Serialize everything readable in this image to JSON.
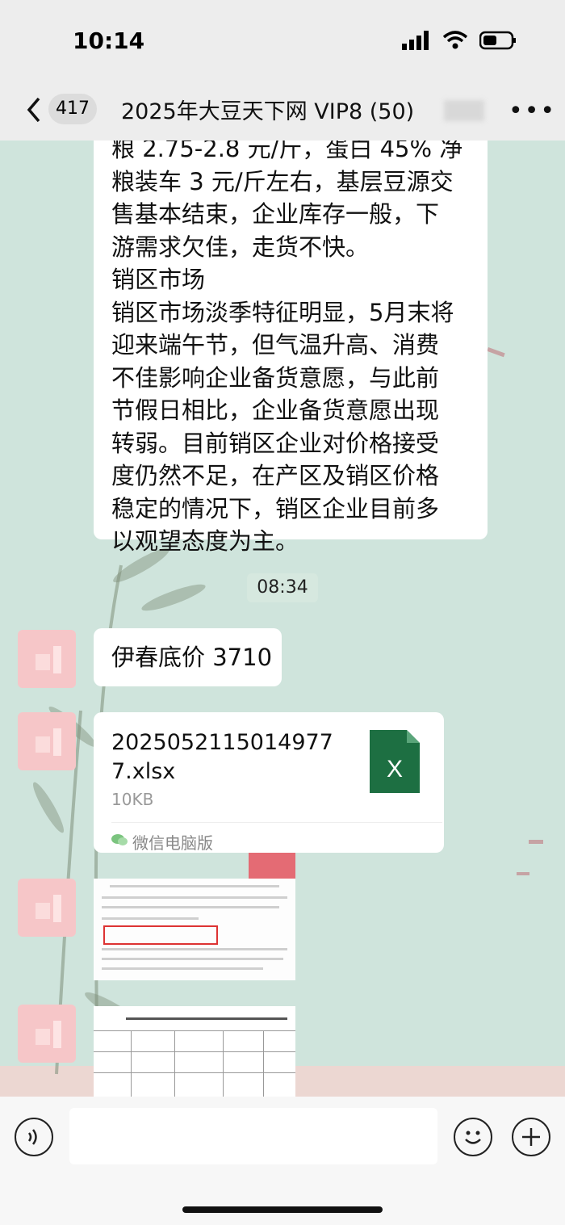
{
  "status_bar": {
    "time": "10:14"
  },
  "nav": {
    "unread_count": "417",
    "chat_title": "2025年大豆天下网 VIP8 (50)"
  },
  "messages": {
    "text_1": "粮 2.75-2.8 元/斤，蛋白 45% 净\n粮装车 3 元/斤左右，基层豆源交\n售基本结束，企业库存一般，下\n游需求欠佳，走货不快。\n销区市场\n销区市场淡季特征明显，5月末将\n迎来端午节，但气温升高、消费\n不佳影响企业备货意愿，与此前\n节假日相比，企业备货意愿出现\n转弱。目前销区企业对价格接受\n度仍然不足，在产区及销区价格\n稳定的情况下，销区企业目前多\n以观望态度为主。",
    "timestamp": "08:34",
    "text_2": "伊春底价 3710",
    "file": {
      "name": "20250521150149777.xlsx",
      "size": "10KB",
      "source": "微信电脑版",
      "icon_letter": "X"
    }
  },
  "colors": {
    "chat_bg": "#cfe4dc",
    "bar_bg": "#ededed",
    "excel_green": "#1d6f42",
    "avatar_pink": "#f6c6c8"
  },
  "icons": [
    "back-icon",
    "signal-icon",
    "wifi-icon",
    "battery-icon",
    "more-icon",
    "excel-icon",
    "wechat-pc-icon",
    "voice-icon",
    "emoji-icon",
    "plus-icon"
  ]
}
